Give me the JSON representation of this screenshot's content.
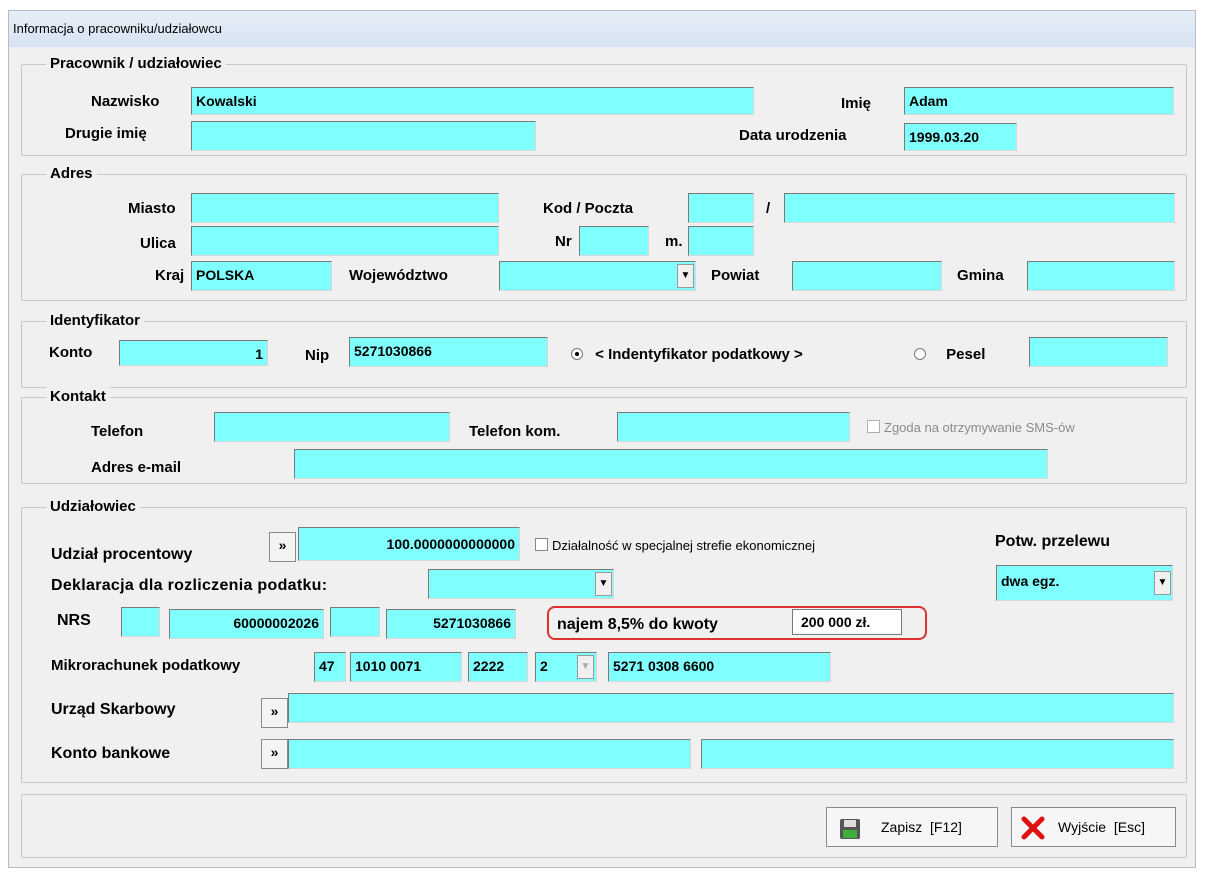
{
  "window": {
    "title": "Informacja o pracowniku/udziałowcu"
  },
  "pracownik": {
    "legend": "Pracownik / udziałowiec",
    "nazwisko_label": "Nazwisko",
    "nazwisko": "Kowalski",
    "imie_label": "Imię",
    "imie": "Adam",
    "drugie_imie_label": "Drugie imię",
    "drugie_imie": "",
    "data_urodzenia_label": "Data urodzenia",
    "data_urodzenia": "1999.03.20"
  },
  "adres": {
    "legend": "Adres",
    "miasto_label": "Miasto",
    "miasto": "",
    "kod_poczta_label": "Kod / Poczta",
    "slash": "/",
    "ulica_label": "Ulica",
    "ulica": "",
    "nr_label": "Nr",
    "m_label": "m.",
    "kraj_label": "Kraj",
    "kraj": "POLSKA",
    "wojewodztwo_label": "Województwo",
    "wojewodztwo": "",
    "powiat_label": "Powiat",
    "gmina_label": "Gmina"
  },
  "identyfikator": {
    "legend": "Identyfikator",
    "konto_label": "Konto",
    "konto": "1",
    "nip_label": "Nip",
    "nip": "5271030866",
    "radio_nip_label": "< Indentyfikator podatkowy >",
    "radio_pesel_label": "Pesel",
    "selected": "nip"
  },
  "kontakt": {
    "legend": "Kontakt",
    "telefon_label": "Telefon",
    "telefon_kom_label": "Telefon kom.",
    "sms_label": "Zgoda na otrzymywanie SMS-ów",
    "email_label": "Adres e-mail"
  },
  "udzialowiec": {
    "legend": "Udziałowiec",
    "udzial_label": "Udział procentowy",
    "more": "»",
    "udzial": "100.0000000000000",
    "sse_label": "Działalność w specjalnej strefie ekonomicznej",
    "potw_label": "Potw. przelewu",
    "potw": "dwa egz.",
    "deklaracja_label": "Deklaracja dla rozliczenia podatku:",
    "deklaracja": "",
    "nrs_label": "NRS",
    "nrs_1": "",
    "nrs_2": "60000002026",
    "nrs_3": "",
    "nrs_4": "5271030866",
    "najem_label": "najem 8,5% do kwoty",
    "najem_kwota": "200 000 zł.",
    "mikro_label": "Mikrorachunek podatkowy",
    "mikro_1": "47",
    "mikro_2": "1010 0071",
    "mikro_3": "2222",
    "mikro_4": "2",
    "mikro_5": "5271 0308 6600",
    "urzad_label": "Urząd Skarbowy",
    "konto_bankowe_label": "Konto bankowe"
  },
  "buttons": {
    "save": "Zapisz  [F12]",
    "exit": "Wyjście  [Esc]"
  },
  "colors": {
    "field": "#80ffff",
    "highlight": "#e03030"
  }
}
